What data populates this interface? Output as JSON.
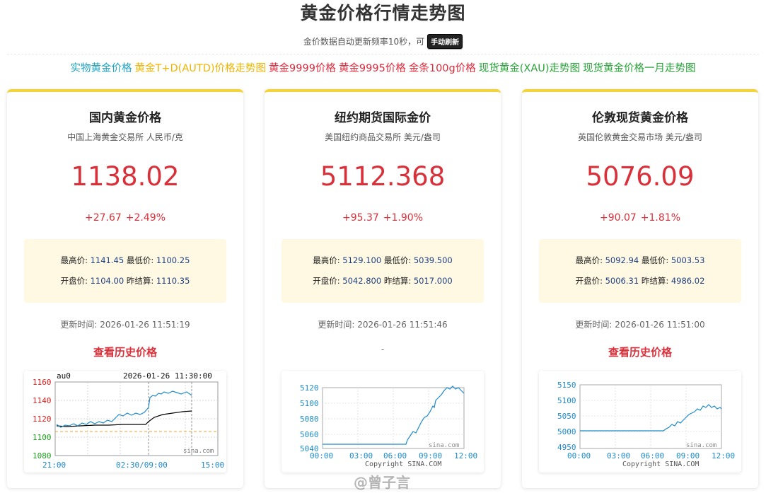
{
  "header": {
    "title": "黄金价格行情走势图",
    "subtitle": "金价数据自动更新频率10秒，可",
    "refresh_label": "手动刷新"
  },
  "links": [
    {
      "label": "实物黄金价格",
      "color": "#1aa3c3"
    },
    {
      "label": "黄金T+D(AUTD)价格走势图",
      "color": "#f0b400"
    },
    {
      "label": "黄金9999价格",
      "color": "#e0283a"
    },
    {
      "label": "黄金9995价格",
      "color": "#e0283a"
    },
    {
      "label": "金条100g价格",
      "color": "#e0283a"
    },
    {
      "label": "现货黄金(XAU)走势图",
      "color": "#27a337"
    },
    {
      "label": "现货黄金价格一月走势图",
      "color": "#27a337"
    }
  ],
  "cards": [
    {
      "title": "国内黄金价格",
      "subtitle": "中国上海黄金交易所 人民币/克",
      "price": "1138.02",
      "change": "+27.67",
      "change_pct": "+2.49%",
      "high_label": "最高价:",
      "high": "1141.45",
      "low_label": "最低价:",
      "low": "1100.25",
      "open_label": "开盘价:",
      "open": "1104.00",
      "prev_label": "昨结算:",
      "prev": "1110.35",
      "update": "更新时间: 2026-01-26 11:51:19",
      "link": "查看历史价格",
      "chart": {
        "code": "au0",
        "datetime": "2026-01-26 11:30:00",
        "y_ticks": [
          "1160",
          "1140",
          "1120",
          "1100",
          "1080"
        ],
        "x_ticks": [
          "21:00",
          "02:30/09:00",
          "15:00"
        ],
        "watermark": "sina.com"
      }
    },
    {
      "title": "纽约期货国际金价",
      "subtitle": "美国纽约商品交易所 美元/盎司",
      "price": "5112.368",
      "change": "+95.37",
      "change_pct": "+1.90%",
      "high_label": "最高价:",
      "high": "5129.100",
      "low_label": "最低价:",
      "low": "5039.500",
      "open_label": "开盘价:",
      "open": "5042.800",
      "prev_label": "昨结算:",
      "prev": "5017.000",
      "update": "更新时间: 2026-01-26 11:51:46",
      "link": "-",
      "chart": {
        "y_ticks": [
          "5120",
          "5100",
          "5080",
          "5060",
          "5040"
        ],
        "x_ticks": [
          "00:00",
          "03:00",
          "06:00",
          "09:00",
          "12:00"
        ],
        "watermark": "sina.com",
        "copyright": "Copyright  SINA.COM"
      }
    },
    {
      "title": "伦敦现货黄金价格",
      "subtitle": "英国伦敦黄金交易市场 美元/盎司",
      "price": "5076.09",
      "change": "+90.07",
      "change_pct": "+1.81%",
      "high_label": "最高价:",
      "high": "5092.94",
      "low_label": "最低价:",
      "low": "5003.53",
      "open_label": "开盘价:",
      "open": "5006.31",
      "prev_label": "昨结算:",
      "prev": "4986.02",
      "update": "更新时间: 2026-01-26 11:51:00",
      "link": "查看历史价格",
      "chart": {
        "y_ticks": [
          "5150",
          "5100",
          "5050",
          "5000",
          "4950"
        ],
        "x_ticks": [
          "00:00",
          "03:00",
          "06:00",
          "09:00",
          "12:00"
        ],
        "watermark": "sina.com",
        "copyright": "Copyright  SINA.COM"
      }
    }
  ],
  "watermark": "@曾子言",
  "colors": {
    "accent_yellow": "#f5d43a",
    "price_red": "#d9303a",
    "line_blue": "#1f8ac8",
    "stats_bg": "#fff9e3"
  }
}
